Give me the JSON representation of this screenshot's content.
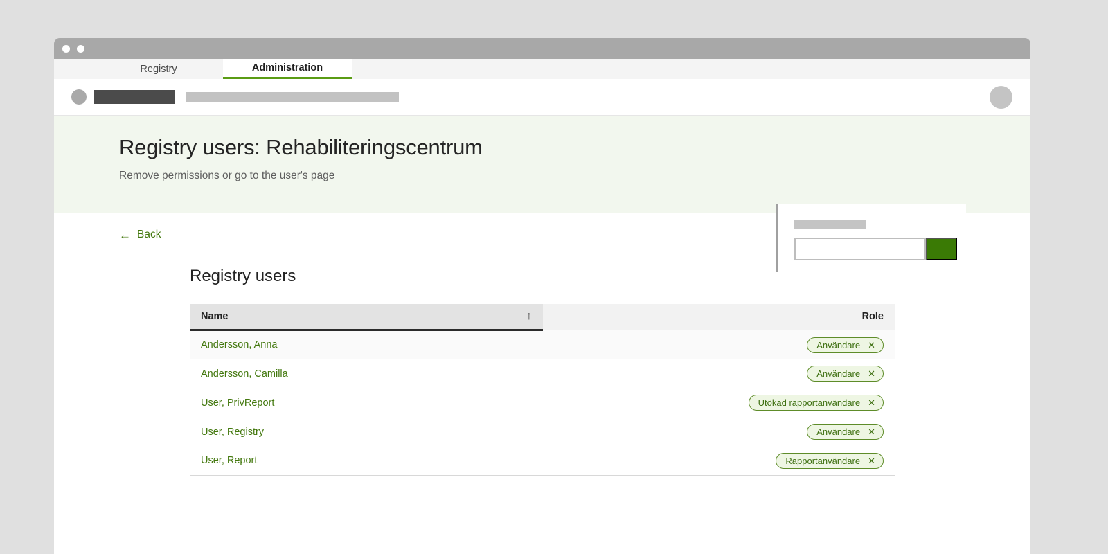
{
  "window": {
    "dots": [
      "window-dot",
      "window-dot"
    ]
  },
  "browser_tabs": [
    {
      "label": "Registry",
      "active": false
    },
    {
      "label": "Administration",
      "active": true
    }
  ],
  "hero": {
    "title": "Registry users: Rehabiliteringscentrum",
    "subtitle": "Remove permissions or go to the user's page",
    "panel": {
      "search_value": "",
      "search_placeholder": "",
      "button_label": ""
    }
  },
  "back_link": {
    "arrow": "←",
    "label": "Back"
  },
  "section": {
    "title": "Registry users"
  },
  "table": {
    "columns": [
      {
        "label": "Name",
        "sorted": true,
        "sort_direction": "asc",
        "sort_icon": "↑"
      },
      {
        "label": "Role",
        "sorted": false
      }
    ],
    "rows": [
      {
        "name": "Andersson, Anna",
        "role": "Användare",
        "remove_icon": "✕",
        "highlighted": true
      },
      {
        "name": "Andersson, Camilla",
        "role": "Användare",
        "remove_icon": "✕",
        "highlighted": false
      },
      {
        "name": "User, PrivReport",
        "role": "Utökad rapportanvändare",
        "remove_icon": "✕",
        "highlighted": false
      },
      {
        "name": "User, Registry",
        "role": "Användare",
        "remove_icon": "✕",
        "highlighted": false
      },
      {
        "name": "User, Report",
        "role": "Rapportanvändare",
        "remove_icon": "✕",
        "highlighted": false
      }
    ]
  },
  "colors": {
    "accent_green": "#43780e",
    "button_green": "#3a7a05",
    "tab_underline": "#5a9c14",
    "hero_background": "#f2f7ee",
    "chip_background": "#eef6e3",
    "chip_border": "#5e8c29",
    "page_background": "#e0e0e0"
  }
}
